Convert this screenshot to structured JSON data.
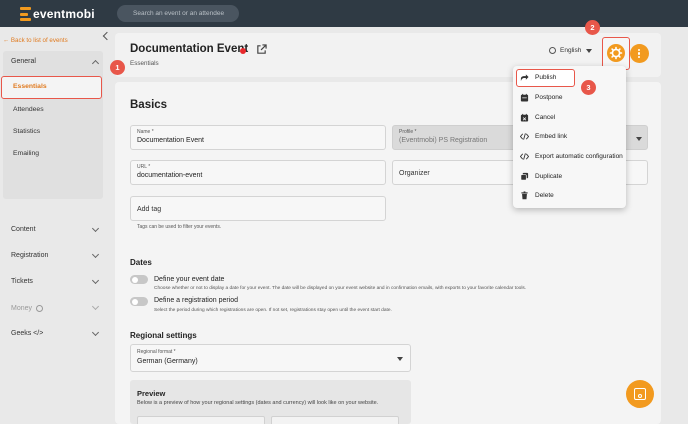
{
  "topbar": {
    "brand": "eventmobi",
    "search_placeholder": "Search an event or an attendee"
  },
  "sidebar": {
    "back_label": "Back to list of events",
    "general": {
      "label": "General",
      "items": [
        "Essentials",
        "Attendees",
        "Statistics",
        "Emailing"
      ],
      "active": "Essentials"
    },
    "sections": [
      {
        "label": "Content"
      },
      {
        "label": "Registration"
      },
      {
        "label": "Tickets"
      },
      {
        "label": "Money"
      },
      {
        "label": "Geeks </>"
      }
    ]
  },
  "badges": {
    "one": "1",
    "two": "2",
    "three": "3"
  },
  "header": {
    "title": "Documentation Event",
    "subtitle": "Essentials",
    "language": "English"
  },
  "basics": {
    "heading": "Basics",
    "name_label": "Name *",
    "name_value": "Documentation Event",
    "profile_label": "Profile *",
    "profile_value": "(Eventmobi) PS Registration",
    "url_label": "URL *",
    "url_value": "documentation-event",
    "organizer_placeholder": "Organizer",
    "tag_placeholder": "Add tag",
    "tag_hint": "Tags can be used to filter your events."
  },
  "dates": {
    "heading": "Dates",
    "event_date_label": "Define your event date",
    "event_date_desc": "Choose whether or not to display a date for your event. The date will be displayed on your event website and in confirmation emails, with exports to your favorite calendar tools.",
    "reg_period_label": "Define a registration period",
    "reg_period_desc": "Select the period during which registrations are open. If not set, registrations stay open until the event start date."
  },
  "regional": {
    "heading": "Regional settings",
    "format_label": "Regional format *",
    "format_value": "German (Germany)"
  },
  "preview": {
    "heading": "Preview",
    "desc": "Below is a preview of how your regional settings (dates and currency) will look like on your website."
  },
  "menu": {
    "items": [
      "Publish",
      "Postpone",
      "Cancel",
      "Embed link",
      "Export automatic configuration",
      "Duplicate",
      "Delete"
    ]
  },
  "colors": {
    "accent": "#f29a1f",
    "highlight": "#e8574a",
    "topbar": "#2f3a44",
    "status_dot": "#e8292c"
  }
}
